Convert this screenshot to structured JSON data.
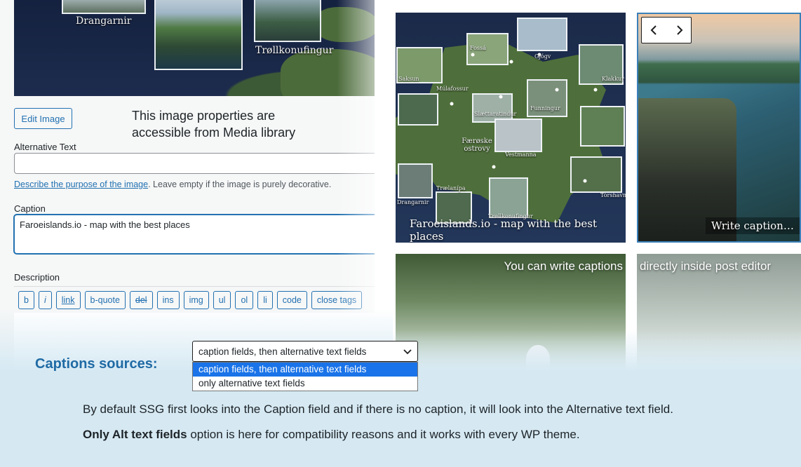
{
  "media_panel": {
    "map_labels": [
      "Drangarnir",
      "Trøllkonufingur"
    ],
    "edit_image_label": "Edit Image",
    "note": "This image properties are\naccessible from Media library",
    "alt_text": {
      "label": "Alternative Text",
      "value": "",
      "help_link": "Describe the purpose of the image",
      "help_rest": ". Leave empty if the image is purely decorative."
    },
    "caption": {
      "label": "Caption",
      "value": "Faroeislands.io - map with the best places"
    },
    "description": {
      "label": "Description",
      "toolbar": [
        "b",
        "i",
        "link",
        "b-quote",
        "del",
        "ins",
        "img",
        "ul",
        "ol",
        "li",
        "code",
        "close tags"
      ]
    }
  },
  "gallery": {
    "map_tile_caption": "Faroeislands.io - map with the best places",
    "map_tile_labels": [
      "Fossá",
      "Gjógv",
      "Saksun",
      "Klakkur",
      "Múlafossur",
      "Funningur",
      "Slættaratindur",
      "Færøske ostrovy",
      "Vestmanna",
      "Trælanípa",
      "Tórshavn",
      "Drangarnir",
      "Trøllkonufingur"
    ],
    "cliff_tile_caption": "Write caption…",
    "puffin_tile_text": "You can write captions",
    "mist_tile_text": "directly inside post editor",
    "nav": {
      "prev_icon": "chevron-left-icon",
      "next_icon": "chevron-right-icon"
    }
  },
  "captions_sources": {
    "title": "Captions sources:",
    "selected": "caption fields, then alternative text fields",
    "options": [
      "caption fields, then alternative text fields",
      "only alternative text fields"
    ],
    "highlighted_index": 0,
    "line1": "By default SSG first looks into the Caption field and if there is no caption, it will look into the Alternative text field.",
    "line2_bold": "Only Alt text fields",
    "line2_rest": " option is here for compatibility reasons and it works with every WP theme."
  },
  "colors": {
    "wp_blue": "#2271b1",
    "band": "#d6e9f3",
    "title_blue": "#1f6aa5",
    "option_highlight": "#1a73e8"
  }
}
